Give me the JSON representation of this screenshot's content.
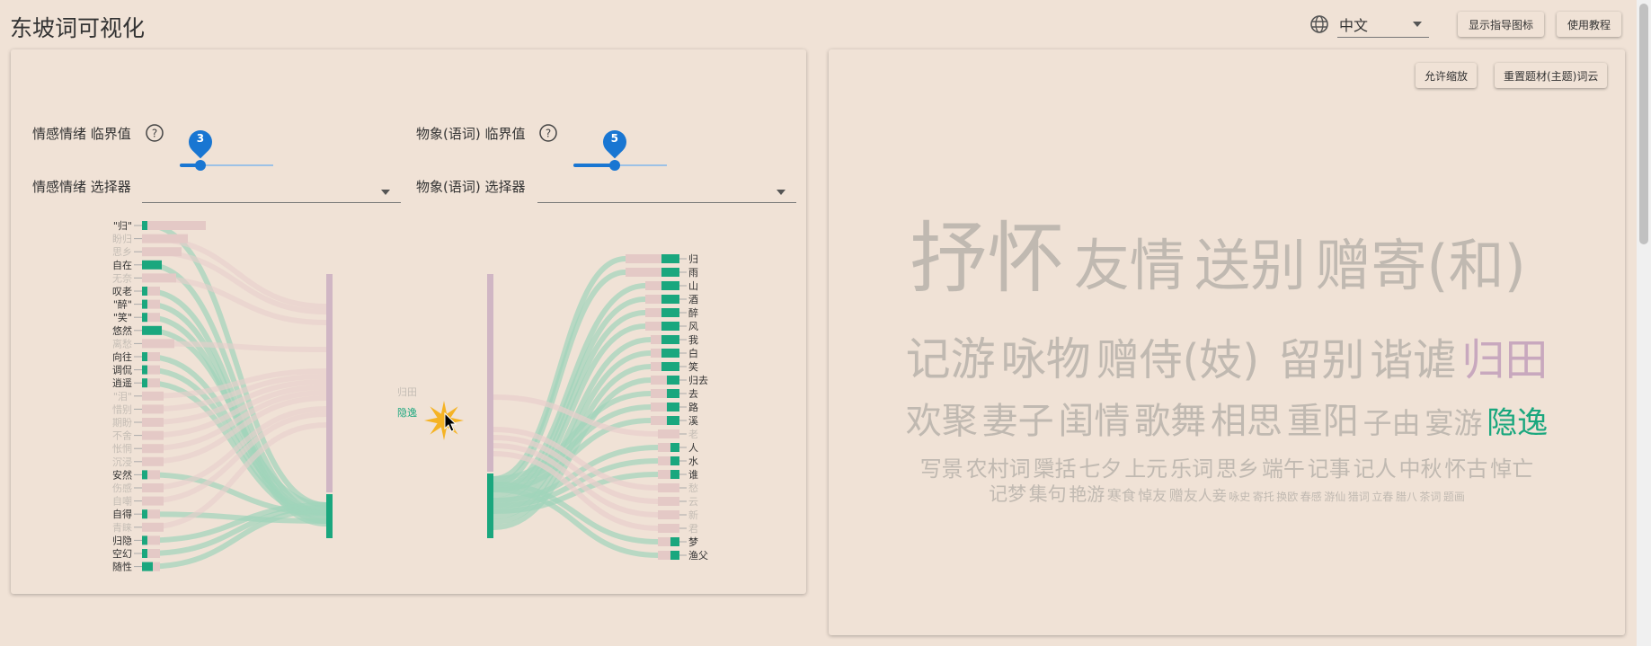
{
  "app": {
    "title": "东坡词可视化"
  },
  "header": {
    "language_icon": "globe-icon",
    "language_value": "中文",
    "show_guide_label": "显示指导图标",
    "tutorial_label": "使用教程"
  },
  "controls": {
    "emotion_threshold_label": "情感情绪 临界值",
    "emotion_threshold_value": 3,
    "emotion_threshold_fraction": 0.22,
    "imagery_threshold_label": "物象(语词) 临界值",
    "imagery_threshold_value": 5,
    "imagery_threshold_fraction": 0.44,
    "emotion_selector_label": "情感情绪 选择器",
    "imagery_selector_label": "物象(语词) 选择器",
    "help_icon": "question-circle-icon"
  },
  "sankey": {
    "emotions": [
      {
        "label": "\"归\"",
        "active": true
      },
      {
        "label": "盼归",
        "active": false
      },
      {
        "label": "思乡",
        "active": false
      },
      {
        "label": "自在",
        "active": true
      },
      {
        "label": "无奈",
        "active": false
      },
      {
        "label": "叹老",
        "active": true
      },
      {
        "label": "\"醉\"",
        "active": true
      },
      {
        "label": "\"笑\"",
        "active": true
      },
      {
        "label": "悠然",
        "active": true
      },
      {
        "label": "离愁",
        "active": false
      },
      {
        "label": "向往",
        "active": true
      },
      {
        "label": "调侃",
        "active": true
      },
      {
        "label": "逍遥",
        "active": true
      },
      {
        "label": "\"泪\"",
        "active": false
      },
      {
        "label": "惜别",
        "active": false
      },
      {
        "label": "期盼",
        "active": false
      },
      {
        "label": "不舍",
        "active": false
      },
      {
        "label": "怅惘",
        "active": false
      },
      {
        "label": "沉浸",
        "active": false
      },
      {
        "label": "安然",
        "active": true
      },
      {
        "label": "伤感",
        "active": false
      },
      {
        "label": "自嘲",
        "active": false
      },
      {
        "label": "自得",
        "active": true
      },
      {
        "label": "青睐",
        "active": false
      },
      {
        "label": "归隐",
        "active": true
      },
      {
        "label": "空幻",
        "active": true
      },
      {
        "label": "随性",
        "active": true
      }
    ],
    "themes": [
      {
        "label": "归田",
        "active": false
      },
      {
        "label": "隐逸",
        "active": true
      }
    ],
    "imagery": [
      {
        "label": "归",
        "active": true
      },
      {
        "label": "雨",
        "active": true
      },
      {
        "label": "山",
        "active": true
      },
      {
        "label": "酒",
        "active": true
      },
      {
        "label": "醉",
        "active": true
      },
      {
        "label": "风",
        "active": true
      },
      {
        "label": "我",
        "active": true
      },
      {
        "label": "白",
        "active": true
      },
      {
        "label": "笑",
        "active": true
      },
      {
        "label": "归去",
        "active": true
      },
      {
        "label": "去",
        "active": true
      },
      {
        "label": "路",
        "active": true
      },
      {
        "label": "溪",
        "active": true
      },
      {
        "label": "老",
        "active": false
      },
      {
        "label": "人",
        "active": true
      },
      {
        "label": "水",
        "active": true
      },
      {
        "label": "谁",
        "active": true
      },
      {
        "label": "愁",
        "active": false
      },
      {
        "label": "云",
        "active": false
      },
      {
        "label": "新",
        "active": false
      },
      {
        "label": "君",
        "active": false
      },
      {
        "label": "梦",
        "active": true
      },
      {
        "label": "渔父",
        "active": true
      }
    ],
    "cursor_icon": "pointer-cursor-icon",
    "burst_icon": "burst-icon"
  },
  "cloud_panel": {
    "allow_zoom_label": "允许缩放",
    "reset_cloud_label": "重置题材(主题)词云"
  },
  "word_cloud": [
    [
      {
        "text": "抒怀",
        "size": 86,
        "color": "#c0b9b1"
      },
      {
        "text": "友情",
        "size": 62,
        "color": "#c0b9b1"
      },
      {
        "text": "送别",
        "size": 62,
        "color": "#c0b9b1"
      },
      {
        "text": "赠寄(和)",
        "size": 62,
        "color": "#c0b9b1"
      }
    ],
    [
      {
        "text": "记游",
        "size": 50,
        "color": "#c0b9b1"
      },
      {
        "text": "咏物",
        "size": 50,
        "color": "#c0b9b1"
      },
      {
        "text": "赠侍(妓)",
        "size": 48,
        "color": "#c0b9b1"
      },
      {
        "text": "留别",
        "size": 48,
        "color": "#c0b9b1"
      },
      {
        "text": "谐谑",
        "size": 48,
        "color": "#c0b9b1"
      },
      {
        "text": "归田",
        "size": 48,
        "color": "#c8a8be"
      }
    ],
    [
      {
        "text": "欢聚",
        "size": 40,
        "color": "#c0b9b1"
      },
      {
        "text": "妻子",
        "size": 40,
        "color": "#c0b9b1"
      },
      {
        "text": "闺情",
        "size": 40,
        "color": "#c0b9b1"
      },
      {
        "text": "歌舞",
        "size": 40,
        "color": "#c0b9b1"
      },
      {
        "text": "相思",
        "size": 40,
        "color": "#c0b9b1"
      },
      {
        "text": "重阳",
        "size": 40,
        "color": "#c0b9b1"
      },
      {
        "text": "子由",
        "size": 32,
        "color": "#c0b9b1"
      },
      {
        "text": "宴游",
        "size": 32,
        "color": "#c0b9b1"
      },
      {
        "text": "隐逸",
        "size": 34,
        "color": "#1aa77e"
      }
    ],
    [
      {
        "text": "写景",
        "size": 24,
        "color": "#c0b9b1"
      },
      {
        "text": "农村词",
        "size": 24,
        "color": "#c0b9b1"
      },
      {
        "text": "檃括",
        "size": 24,
        "color": "#c0b9b1"
      },
      {
        "text": "七夕",
        "size": 24,
        "color": "#c0b9b1"
      },
      {
        "text": "上元",
        "size": 24,
        "color": "#c0b9b1"
      },
      {
        "text": "乐词",
        "size": 24,
        "color": "#c0b9b1"
      },
      {
        "text": "思乡",
        "size": 24,
        "color": "#c0b9b1"
      },
      {
        "text": "端午",
        "size": 24,
        "color": "#c0b9b1"
      },
      {
        "text": "记事",
        "size": 24,
        "color": "#c0b9b1"
      },
      {
        "text": "记人",
        "size": 24,
        "color": "#c0b9b1"
      },
      {
        "text": "中秋",
        "size": 24,
        "color": "#c0b9b1"
      },
      {
        "text": "怀古",
        "size": 24,
        "color": "#c0b9b1"
      },
      {
        "text": "悼亡",
        "size": 24,
        "color": "#c0b9b1"
      }
    ],
    [
      {
        "text": "记梦",
        "size": 21,
        "color": "#c0b9b1"
      },
      {
        "text": "集句",
        "size": 21,
        "color": "#c0b9b1"
      },
      {
        "text": "艳游",
        "size": 20,
        "color": "#c0b9b1"
      },
      {
        "text": "寒食",
        "size": 16,
        "color": "#c0b9b1"
      },
      {
        "text": "悼友",
        "size": 16,
        "color": "#c0b9b1"
      },
      {
        "text": "赠友人妾",
        "size": 16,
        "color": "#c0b9b1"
      },
      {
        "text": "咏史",
        "size": 12,
        "color": "#c0b9b1"
      },
      {
        "text": "寄托",
        "size": 12,
        "color": "#c0b9b1"
      },
      {
        "text": "换欧",
        "size": 12,
        "color": "#c0b9b1"
      },
      {
        "text": "春感",
        "size": 12,
        "color": "#c0b9b1"
      },
      {
        "text": "游仙",
        "size": 12,
        "color": "#c0b9b1"
      },
      {
        "text": "猎词",
        "size": 12,
        "color": "#c0b9b1"
      },
      {
        "text": "立春",
        "size": 12,
        "color": "#c0b9b1"
      },
      {
        "text": "腊八",
        "size": 12,
        "color": "#c0b9b1"
      },
      {
        "text": "茶词",
        "size": 12,
        "color": "#c0b9b1"
      },
      {
        "text": "题画",
        "size": 12,
        "color": "#c0b9b1"
      }
    ]
  ],
  "colors": {
    "accent": "#1976d2",
    "active_node": "#1aa77e",
    "inactive_node": "#e4c9c6",
    "link": "#9fd4bb",
    "theme_bar": "#d0b6c4",
    "background": "#f0e2d6"
  }
}
